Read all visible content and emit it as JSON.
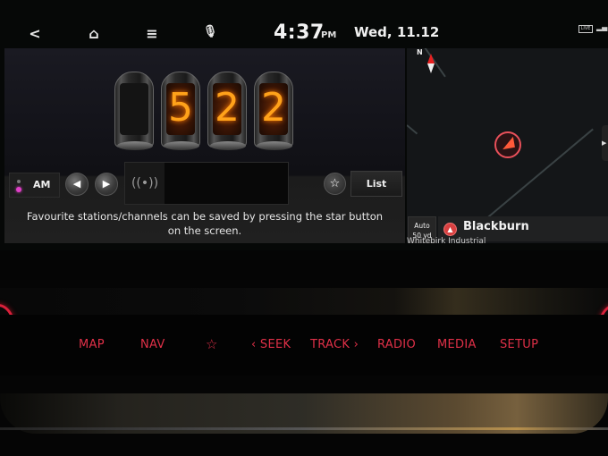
{
  "status_bar": {
    "icons": [
      {
        "name": "back-icon",
        "glyph": "<"
      },
      {
        "name": "home-icon",
        "glyph": "⌂"
      },
      {
        "name": "menu-icon",
        "glyph": "≡"
      },
      {
        "name": "microphone-icon",
        "glyph": "🎙"
      }
    ],
    "time": "4:37",
    "ampm": "PM",
    "date": "Wed, 11.12",
    "live_badge": "LIVE",
    "signal_glyph": "▂▄"
  },
  "radio": {
    "frequency_digits": [
      "",
      "5",
      "2",
      "2"
    ],
    "band": {
      "label": "AM",
      "indicator_color": "#e040c8"
    },
    "prev_glyph": "◀",
    "next_glyph": "▶",
    "antenna_glyph": "((•))",
    "star_glyph": "☆",
    "list_label": "List",
    "hint": "Favourite stations/channels can be saved by pressing the star button on the screen."
  },
  "map": {
    "north_label": "N",
    "scale_line1": "Auto",
    "scale_line2": "50 yd",
    "location_icon_glyph": "▲",
    "location_name": "Blackburn",
    "area_label": "Whitebirk Industrial",
    "side_tab_glyph": "▶",
    "marker_color": "#e8505a"
  },
  "hardware_buttons": [
    {
      "label": "MAP"
    },
    {
      "label": "NAV"
    },
    {
      "label": "☆"
    },
    {
      "label": "‹ SEEK"
    },
    {
      "label": "TRACK ›"
    },
    {
      "label": "RADIO"
    },
    {
      "label": "MEDIA"
    },
    {
      "label": "SETUP"
    }
  ],
  "colors": {
    "hardware_accent": "#e03048",
    "nixie_glow": "#ffa21a"
  }
}
